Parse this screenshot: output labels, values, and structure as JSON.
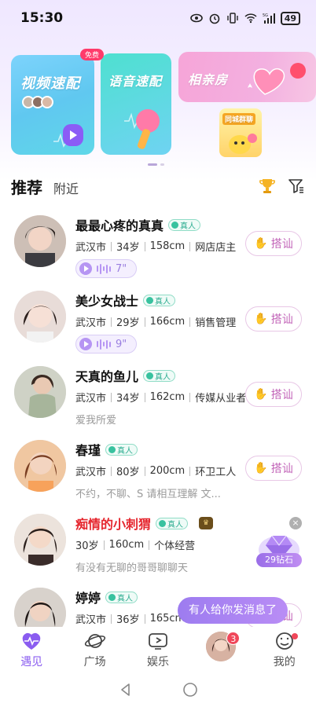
{
  "status_bar": {
    "time": "15:30",
    "battery": "49",
    "network": "5G"
  },
  "banners": {
    "video": {
      "title": "视频速配",
      "badge": "免费"
    },
    "voice": {
      "title": "语音速配"
    },
    "date": {
      "title": "相亲房"
    },
    "small": {
      "title": "同城群聊"
    }
  },
  "tabs": {
    "recommend": "推荐",
    "nearby": "附近"
  },
  "users": [
    {
      "name": "最最心疼的真真",
      "verified": "真人",
      "city": "武汉市",
      "age": "34岁",
      "height": "158cm",
      "job": "网店店主",
      "voice": "7\"",
      "greet": "搭讪"
    },
    {
      "name": "美少女战士",
      "verified": "真人",
      "city": "武汉市",
      "age": "29岁",
      "height": "166cm",
      "job": "销售管理",
      "voice": "9\"",
      "greet": "搭讪"
    },
    {
      "name": "天真的鱼儿",
      "verified": "真人",
      "city": "武汉市",
      "age": "34岁",
      "height": "162cm",
      "job": "传媒从业者",
      "sign": "爱我所爱",
      "greet": "搭讪"
    },
    {
      "name": "春瑾",
      "verified": "真人",
      "city": "武汉市",
      "age": "80岁",
      "height": "200cm",
      "job": "环卫工人",
      "sign": "不约，不聊、S  请相互理解 文...",
      "greet": "搭讪"
    },
    {
      "name": "痴情的小刺猬",
      "verified": "真人",
      "age": "30岁",
      "height": "160cm",
      "job": "个体经营",
      "sign": "有没有无聊的哥哥聊聊天"
    },
    {
      "name": "婷婷",
      "verified": "真人",
      "city": "武汉市",
      "age": "36岁",
      "height": "165cm",
      "greet": "搭讪"
    }
  ],
  "gift": {
    "label": "29钻石",
    "close": "×"
  },
  "toast": "有人给你发消息了",
  "bottom_nav": {
    "items": [
      {
        "label": "遇见",
        "icon": "heart-pulse-icon"
      },
      {
        "label": "广场",
        "icon": "planet-icon"
      },
      {
        "label": "娱乐",
        "icon": "play-box-icon"
      },
      {
        "label": "",
        "icon": "message-avatar",
        "badge": "3"
      },
      {
        "label": "我的",
        "icon": "smile-face-icon"
      }
    ]
  },
  "colors": {
    "accent": "#8a5cf0",
    "red": "#e5262e",
    "verified": "#2fae92"
  }
}
